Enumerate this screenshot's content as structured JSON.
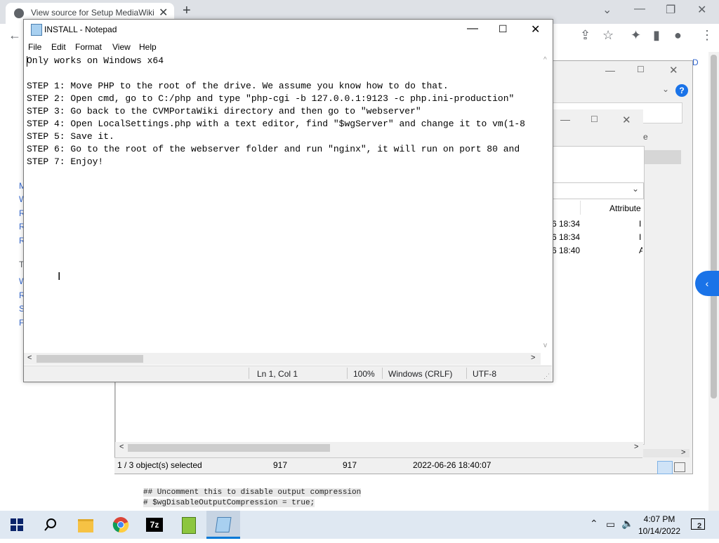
{
  "browser": {
    "tab_title": "View source for Setup MediaWiki",
    "tab_close": "✕",
    "new_tab": "+",
    "win_min": "—",
    "win_restore": "❐",
    "win_close": "✕",
    "back": "←"
  },
  "page": {
    "side_links_top": [
      "M",
      "W",
      "R",
      "R",
      "R"
    ],
    "side_head": "T",
    "side_links_bottom": [
      "W",
      "R",
      "S",
      "F"
    ],
    "right_text": "Descript",
    "code_lines": [
      "## Uncomment this to disable output compression",
      "# $wgDisableOutputCompression = true;"
    ]
  },
  "archive_window": {
    "column_attributes": "Attribute",
    "column_letter": "e",
    "rows": [
      {
        "time": "6 18:34",
        "attr": "I"
      },
      {
        "time": "6 18:34",
        "attr": "I"
      },
      {
        "time": "6 18:40",
        "attr": "A"
      }
    ],
    "status": {
      "selection": "1 / 3 object(s) selected",
      "size": "917",
      "packed": "917",
      "modified": "2022-06-26 18:40:07"
    },
    "help": "?"
  },
  "notepad": {
    "title": "INSTALL - Notepad",
    "menu": {
      "file": "File",
      "edit": "Edit",
      "format": "Format",
      "view": "View",
      "help": "Help"
    },
    "lines": [
      "Only works on Windows x64",
      "",
      "STEP 1: Move PHP to the root of the drive. We assume you know how to do that.",
      "STEP 2: Open cmd, go to C:/php and type \"php-cgi -b 127.0.0.1:9123 -c php.ini-production\"",
      "STEP 3: Go back to the CVMPortaWiki directory and then go to \"webserver\"",
      "STEP 4: Open LocalSettings.php with a text editor, find \"$wgServer\" and change it to vm(1-8",
      "STEP 5: Save it.",
      "STEP 6: Go to the root of the webserver folder and run \"nginx\", it will run on port 80 and",
      "STEP 7: Enjoy!"
    ],
    "status": {
      "position": "Ln 1, Col 1",
      "zoom": "100%",
      "line_ending": "Windows (CRLF)",
      "encoding": "UTF-8"
    },
    "scroll_left": "<",
    "scroll_right": ">",
    "scroll_up": "^",
    "scroll_down": "v"
  },
  "taskbar": {
    "time": "4:07 PM",
    "date": "10/14/2022",
    "notifications": "2",
    "sevenzip_label": "7z"
  }
}
